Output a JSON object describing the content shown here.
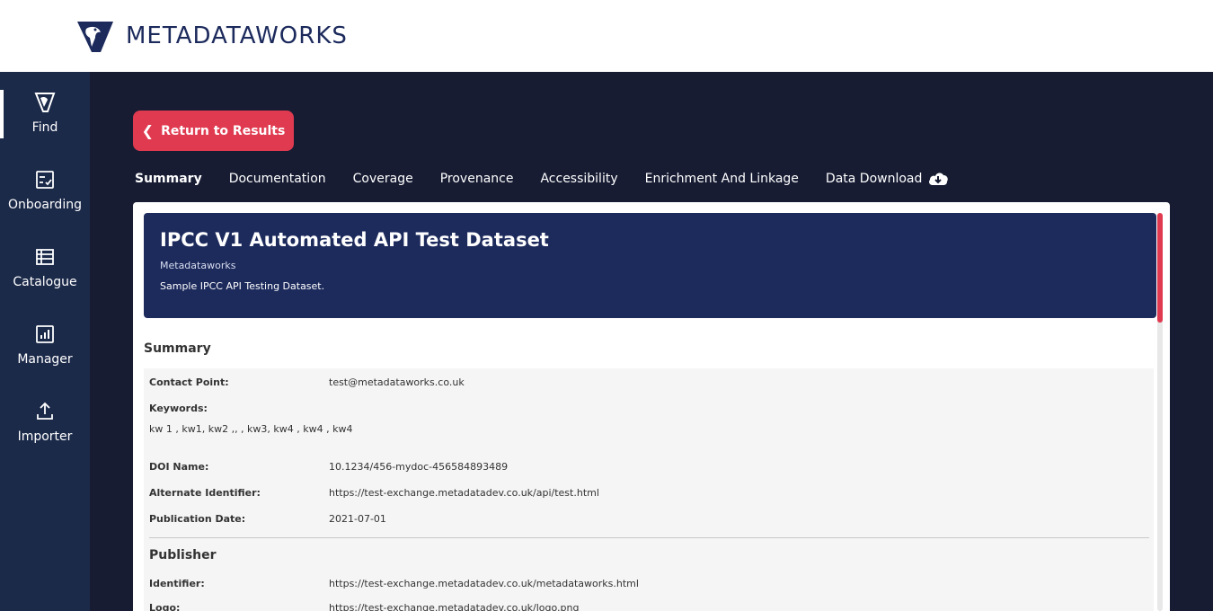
{
  "header": {
    "logo_text_light": "METADATA",
    "logo_text_bold": "WORKS"
  },
  "sidebar": {
    "items": [
      {
        "label": "Find",
        "icon": "find-icon",
        "active": true
      },
      {
        "label": "Onboarding",
        "icon": "checklist-icon",
        "active": false
      },
      {
        "label": "Catalogue",
        "icon": "list-icon",
        "active": false
      },
      {
        "label": "Manager",
        "icon": "chart-icon",
        "active": false
      },
      {
        "label": "Importer",
        "icon": "upload-icon",
        "active": false
      }
    ]
  },
  "main": {
    "return_label": "Return to Results",
    "tabs": [
      {
        "label": "Summary",
        "active": true
      },
      {
        "label": "Documentation",
        "active": false
      },
      {
        "label": "Coverage",
        "active": false
      },
      {
        "label": "Provenance",
        "active": false
      },
      {
        "label": "Accessibility",
        "active": false
      },
      {
        "label": "Enrichment And Linkage",
        "active": false
      },
      {
        "label": "Data Download",
        "active": false,
        "icon": "cloud-download-icon"
      }
    ]
  },
  "dataset": {
    "title": "IPCC V1 Automated API Test Dataset",
    "publisher": "Metadataworks",
    "description": "Sample IPCC API Testing Dataset."
  },
  "summary": {
    "section_title": "Summary",
    "contact_label": "Contact Point:",
    "contact_value": "test@metadataworks.co.uk",
    "keywords_label": "Keywords:",
    "keywords_value": "kw 1 , kw1, kw2 ,, , kw3, kw4 , kw4 , kw4",
    "doi_label": "DOI Name:",
    "doi_value": "10.1234/456-mydoc-456584893489",
    "alt_id_label": "Alternate Identifier:",
    "alt_id_value": "https://test-exchange.metadatadev.co.uk/api/test.html",
    "pub_date_label": "Publication Date:",
    "pub_date_value": "2021-07-01"
  },
  "publisher": {
    "section_title": "Publisher",
    "identifier_label": "Identifier:",
    "identifier_value": "https://test-exchange.metadatadev.co.uk/metadataworks.html",
    "logo_label": "Logo:",
    "logo_value": "https://test-exchange.metadatadev.co.uk/logo.png"
  },
  "colors": {
    "accent": "#e03a50",
    "sidebar_bg": "#1c2a4a",
    "main_bg": "#171c33",
    "hero_bg": "#1c2a5c"
  }
}
